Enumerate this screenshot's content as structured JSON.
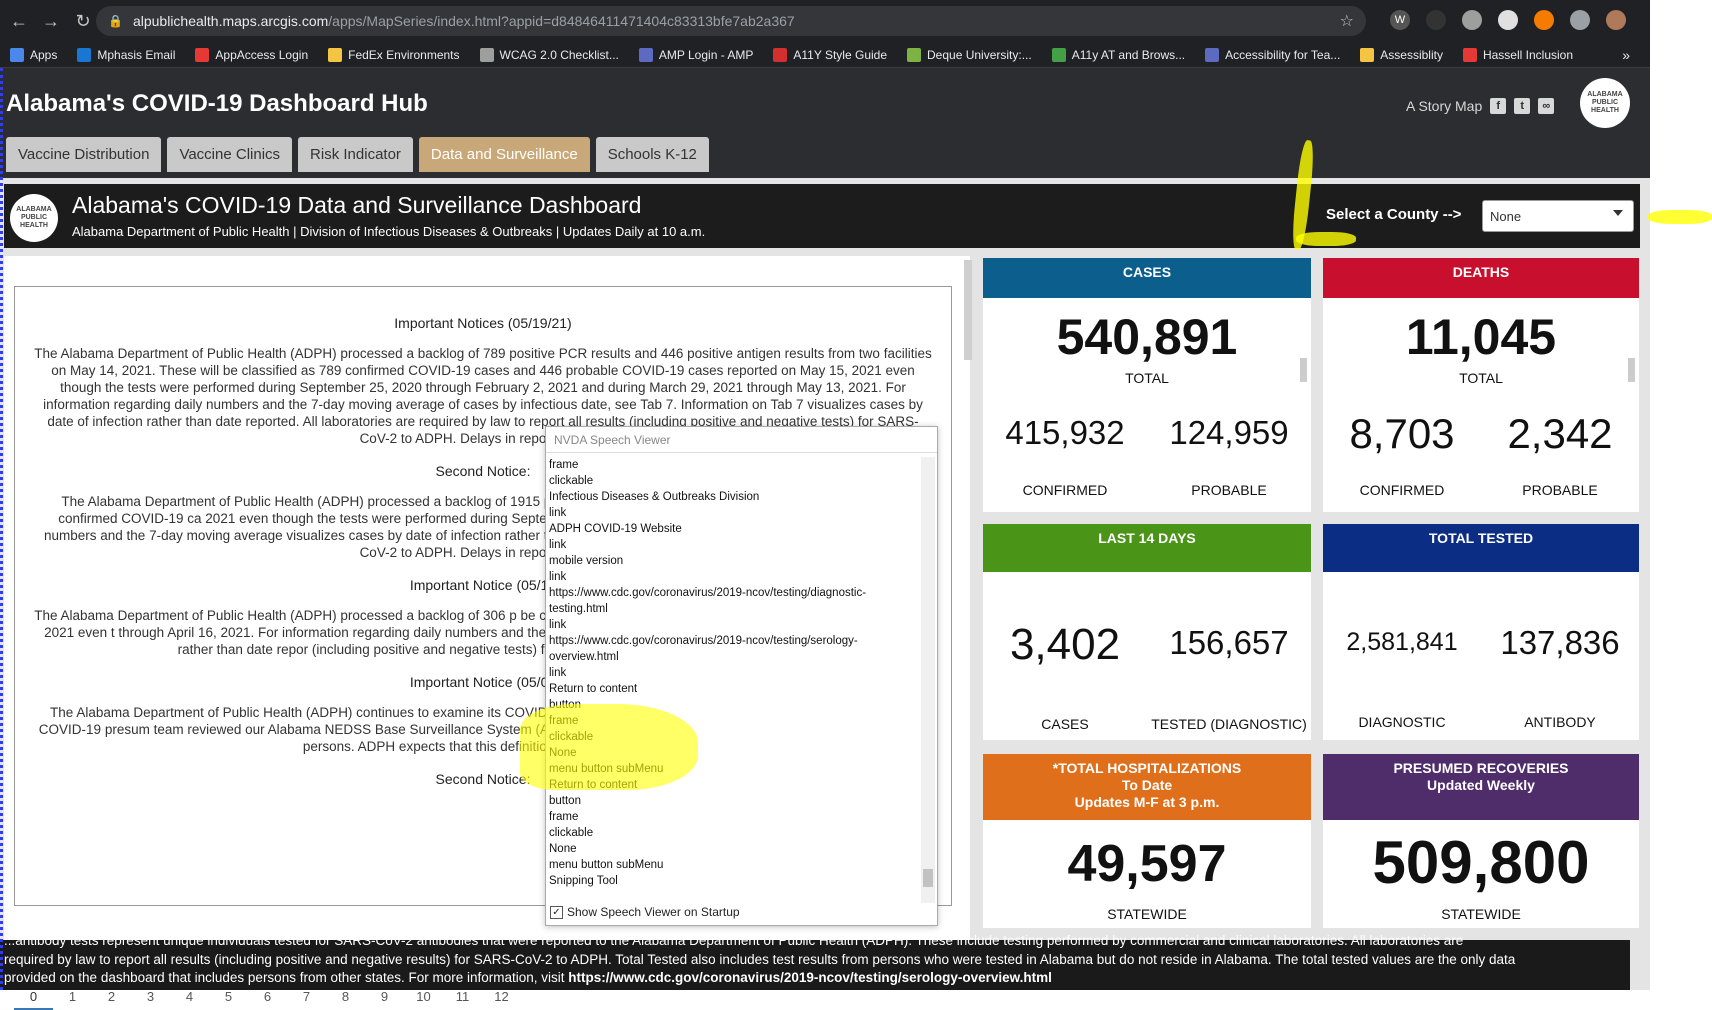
{
  "browser": {
    "url_host": "alpublichealth.maps.arcgis.com",
    "url_path": "/apps/MapSeries/index.html?appid=d84846411471404c83313bfe7ab2a367",
    "bookmarks": [
      {
        "label": "Apps",
        "color": "#4a88ec"
      },
      {
        "label": "Mphasis Email",
        "color": "#1976d2"
      },
      {
        "label": "AppAccess Login",
        "color": "#e53935"
      },
      {
        "label": "FedEx Environments",
        "color": "#f4c542"
      },
      {
        "label": "WCAG 2.0 Checklist...",
        "color": "#9e9e9e"
      },
      {
        "label": "AMP Login - AMP",
        "color": "#5c6bc0"
      },
      {
        "label": "A11Y Style Guide",
        "color": "#d32f2f"
      },
      {
        "label": "Deque University:...",
        "color": "#7cb342"
      },
      {
        "label": "A11y AT and Brows...",
        "color": "#43a047"
      },
      {
        "label": "Accessibility for Tea...",
        "color": "#5c6bc0"
      },
      {
        "label": "Assessiblity",
        "color": "#f4c542"
      },
      {
        "label": "Hassell Inclusion",
        "color": "#e53935"
      }
    ]
  },
  "app": {
    "title": "Alabama's COVID-19 Dashboard Hub",
    "story_map": "A Story Map",
    "logo_text": "ALABAMA PUBLIC HEALTH",
    "tabs": [
      "Vaccine Distribution",
      "Vaccine Clinics",
      "Risk Indicator",
      "Data and Surveillance",
      "Schools K-12"
    ],
    "active_tab": "Data and Surveillance"
  },
  "dashboard": {
    "title": "Alabama's COVID-19 Data and Surveillance Dashboard",
    "subtitle": "Alabama Department of Public Health | Division of Infectious Diseases & Outbreaks | Updates Daily at 10 a.m.",
    "county_label": "Select a County -->",
    "county_value": "None"
  },
  "notices": {
    "h1": "Important Notices (05/19/21)",
    "p1": "The Alabama Department of Public Health (ADPH) processed a backlog of 789 positive PCR results and 446 positive antigen results from two facilities on May 14, 2021. These will be classified as 789 confirmed COVID-19 cases and 446 probable COVID-19 cases reported on May 15, 2021 even though the tests were performed during September 25, 2020 through February 2, 2021 and during March 29, 2021 through May 13, 2021. For information regarding daily numbers and the 7-day moving average of cases by infectious date, see Tab 7. Information on Tab 7 visualizes cases by date of infection rather than date reported. All laboratories are required by law to report all results (including positive and negative tests) for SARS-CoV-2 to ADPH. Delays in reporting by re",
    "h2": "Second Notice:",
    "p2": "The Alabama Department of Public Health (ADPH) processed a backlog of 1915 p facilities on May 13, 2021. These will be classified as 1915 confirmed COVID-19 ca 2021 even though the tests were performed during September 25, 2020 through 2021. For information regarding daily numbers and the 7-day moving average visualizes cases by date of infection rather than date reported. All laboratories ar negative tests) for SARS-CoV-2 to ADPH. Delays in reporting by re",
    "h3": "Important Notice (05/13",
    "p3": "The Alabama Department of Public Health (ADPH) processed a backlog of 306 p be classified as 306 confirmed COVID-19 cases reported on May 13, 2021 even t through April 16, 2021. For information regarding daily numbers and the 7-da Information on Tab 7 visualizes cases by date of infection rather than date repor (including positive and negative tests) for SARS-CoV-2 to ADPH. Delays in repo",
    "h4": "Important Notice (05/08",
    "p4": "The Alabama Department of Public Health (ADPH) continues to examine its COVID current status of this pandemic. In order to reflect numbers of COVID-19 presum team reviewed our Alabama NEDSS Base Surveillance System (ALNBS) and updat presumed recoveries from COVID of 509,800 persons. ADPH expects that this definition of presumed reco",
    "h5": "Second Notice:",
    "page_tabs": [
      "0",
      "1",
      "2",
      "3",
      "4",
      "5",
      "6",
      "7",
      "8",
      "9",
      "10",
      "11",
      "12"
    ],
    "active_page": "0"
  },
  "cards": {
    "cases": {
      "head": "CASES",
      "total": "540,891",
      "total_label": "TOTAL",
      "confirmed": "415,932",
      "probable": "124,959",
      "confirmed_label": "CONFIRMED",
      "probable_label": "PROBABLE",
      "color": "#0c5f8c"
    },
    "deaths": {
      "head": "DEATHS",
      "total": "11,045",
      "total_label": "TOTAL",
      "confirmed": "8,703",
      "probable": "2,342",
      "confirmed_label": "CONFIRMED",
      "probable_label": "PROBABLE",
      "color": "#c8102e"
    },
    "last14": {
      "head": "LAST 14 DAYS",
      "a": "3,402",
      "b": "156,657",
      "a_label": "CASES",
      "b_label": "TESTED (DIAGNOSTIC)",
      "color": "#4a9418"
    },
    "tested": {
      "head": "TOTAL TESTED",
      "a": "2,581,841",
      "b": "137,836",
      "a_label": "DIAGNOSTIC",
      "b_label": "ANTIBODY",
      "color": "#0b2e84"
    },
    "hosp": {
      "head1": "*TOTAL HOSPITALIZATIONS",
      "head2": "To Date",
      "head3": "Updates M-F at 3 p.m.",
      "value": "49,597",
      "label": "STATEWIDE",
      "color": "#e06f1c"
    },
    "recov": {
      "head1": "PRESUMED RECOVERIES",
      "head2": "Updated Weekly",
      "value": "509,800",
      "label": "STATEWIDE",
      "color": "#4f2d6b"
    }
  },
  "bottom_text": {
    "line0": "...antibody tests represent unique individuals tested for SARS-CoV-2 antibodies that were reported to the Alabama Department of Public Health (ADPH). These include testing performed by commercial and clinical laboratories. All laboratories are",
    "line1": "required by law to report all results (including positive and negative results) for SARS-CoV-2 to ADPH. Total Tested also includes test results from persons who were tested in Alabama but do not reside in Alabama. The total tested values are the only data",
    "line2_prefix": "provided on the dashboard that includes persons from other states. For more information, visit ",
    "line2_link": "https://www.cdc.gov/coronavirus/2019-ncov/testing/serology-overview.html"
  },
  "nvda": {
    "title": "NVDA Speech Viewer",
    "lines": [
      "frame",
      "clickable",
      "Infectious Diseases & Outbreaks Division",
      "link",
      "ADPH COVID-19 Website",
      "link",
      "mobile version",
      "link",
      "https://www.cdc.gov/coronavirus/2019-ncov/testing/diagnostic-testing.html",
      "link",
      "https://www.cdc.gov/coronavirus/2019-ncov/testing/serology-overview.html",
      "link",
      "Return to content",
      "button",
      "frame",
      "clickable",
      "None",
      "menu button  subMenu",
      "Return to content",
      "button",
      "frame",
      "clickable",
      "None",
      "menu button  subMenu",
      "Snipping Tool"
    ],
    "footer": "Show Speech Viewer on Startup"
  }
}
